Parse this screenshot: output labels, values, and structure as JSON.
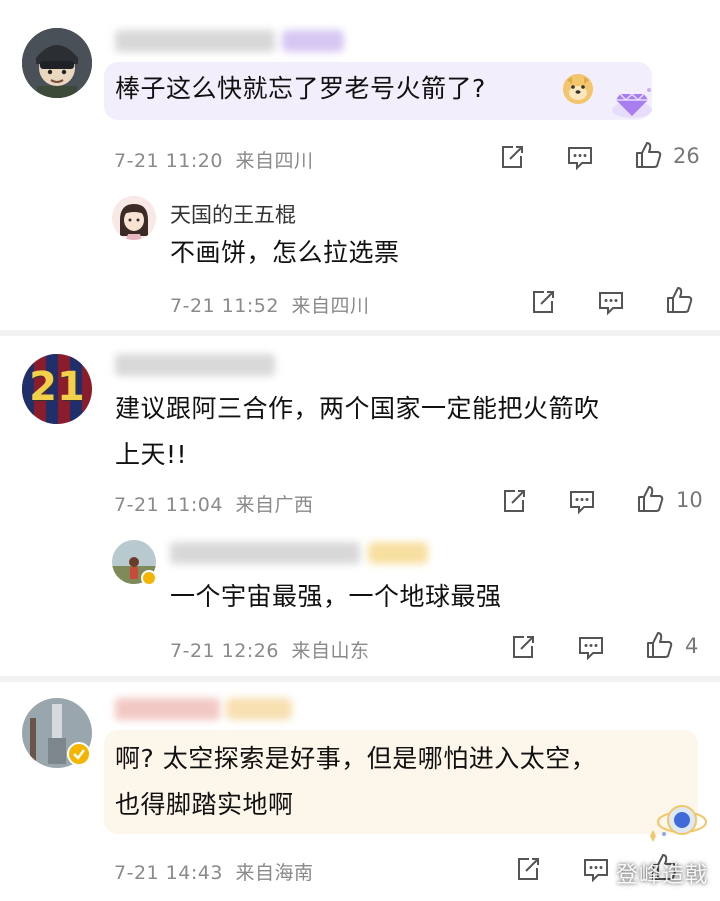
{
  "comments": [
    {
      "text": "棒子这么快就忘了罗老号火箭了?",
      "date": "7-21 11:20",
      "location": "来自四川",
      "likes": "26",
      "reply": {
        "username": "天国的王五棍",
        "text": "不画饼，怎么拉选票",
        "date": "7-21 11:52",
        "location": "来自四川",
        "likes": ""
      }
    },
    {
      "text_line1": "建议跟阿三合作，两个国家一定能把火箭吹",
      "text_line2": "上天!!",
      "avatar_number": "21",
      "date": "7-21 11:04",
      "location": "来自广西",
      "likes": "10",
      "reply": {
        "text": "一个宇宙最强，一个地球最强",
        "date": "7-21 12:26",
        "location": "来自山东",
        "likes": "4"
      }
    },
    {
      "text_line1": "啊? 太空探索是好事，但是哪怕进入太空，",
      "text_line2": "也得脚踏实地啊",
      "date": "7-21 14:43",
      "location": "来自海南",
      "likes": ""
    }
  ],
  "watermark": "登峰造戟",
  "colors": {
    "bubble1": "#f3eefb",
    "bubble3": "#fdf6ea",
    "icon": "#555555",
    "separator": "#f2f2f2"
  }
}
